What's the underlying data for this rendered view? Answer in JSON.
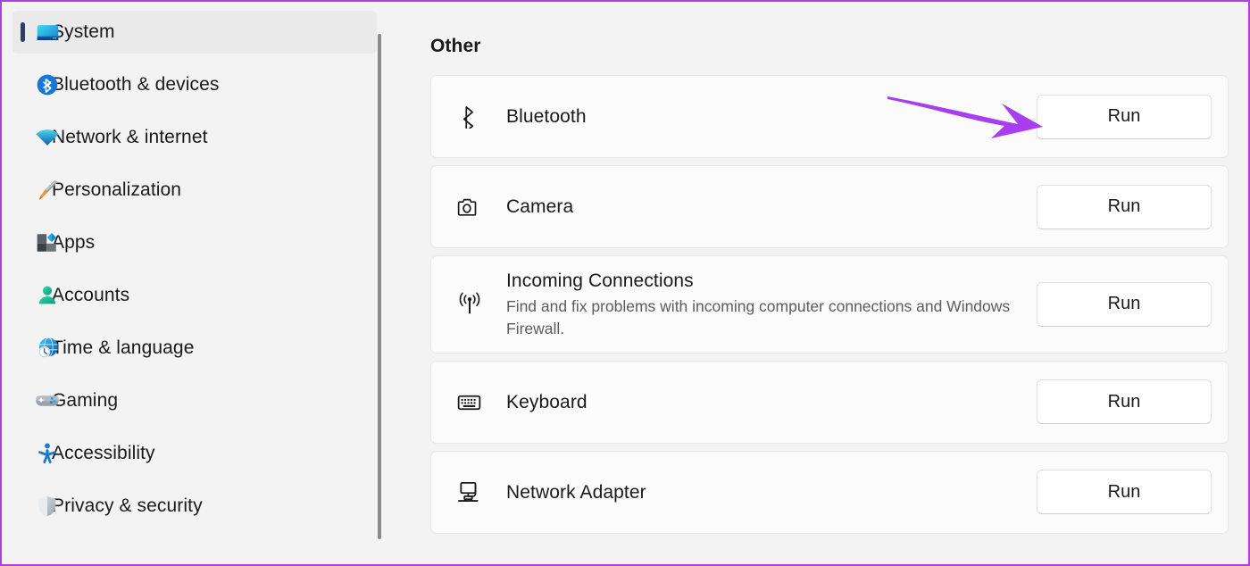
{
  "window": {
    "accent_border_color": "#b33ee0",
    "page_background": "#f3f3f3",
    "card_background": "#fbfbfb",
    "selection_indicator_color": "#2e3d6b"
  },
  "sidebar": {
    "items": [
      {
        "label": "System",
        "icon": "monitor-icon",
        "selected": true
      },
      {
        "label": "Bluetooth & devices",
        "icon": "bluetooth-icon",
        "selected": false
      },
      {
        "label": "Network & internet",
        "icon": "wifi-icon",
        "selected": false
      },
      {
        "label": "Personalization",
        "icon": "paintbrush-icon",
        "selected": false
      },
      {
        "label": "Apps",
        "icon": "apps-icon",
        "selected": false
      },
      {
        "label": "Accounts",
        "icon": "person-icon",
        "selected": false
      },
      {
        "label": "Time & language",
        "icon": "clock-globe-icon",
        "selected": false
      },
      {
        "label": "Gaming",
        "icon": "gamepad-icon",
        "selected": false
      },
      {
        "label": "Accessibility",
        "icon": "accessibility-person-icon",
        "selected": false
      },
      {
        "label": "Privacy & security",
        "icon": "shield-icon",
        "selected": false
      }
    ]
  },
  "main": {
    "heading": "Other",
    "cards": [
      {
        "title": "Bluetooth",
        "description": "",
        "icon": "bluetooth-outline-icon",
        "button_label": "Run"
      },
      {
        "title": "Camera",
        "description": "",
        "icon": "camera-icon",
        "button_label": "Run"
      },
      {
        "title": "Incoming Connections",
        "description": "Find and fix problems with incoming computer connections and Windows Firewall.",
        "icon": "antenna-signal-icon",
        "button_label": "Run"
      },
      {
        "title": "Keyboard",
        "description": "",
        "icon": "keyboard-icon",
        "button_label": "Run"
      },
      {
        "title": "Network Adapter",
        "description": "",
        "icon": "network-adapter-icon",
        "button_label": "Run"
      }
    ]
  },
  "annotation": {
    "arrow_color": "#a83ef0",
    "points_to": "Run"
  }
}
